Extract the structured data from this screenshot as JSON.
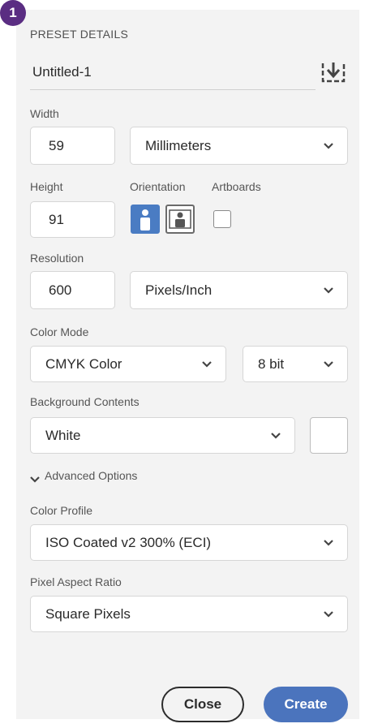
{
  "step_badge": "1",
  "preset": {
    "section_label": "PRESET DETAILS",
    "document_name": "Untitled-1",
    "save_preset_icon": "save-preset-icon"
  },
  "width": {
    "label": "Width",
    "value": "59",
    "unit": "Millimeters"
  },
  "height": {
    "label": "Height",
    "value": "91"
  },
  "orientation": {
    "label": "Orientation",
    "selected": "portrait",
    "options": [
      "portrait",
      "landscape"
    ]
  },
  "artboards": {
    "label": "Artboards",
    "checked": false
  },
  "resolution": {
    "label": "Resolution",
    "value": "600",
    "unit": "Pixels/Inch"
  },
  "color_mode": {
    "label": "Color Mode",
    "mode": "CMYK Color",
    "depth": "8 bit"
  },
  "background": {
    "label": "Background Contents",
    "value": "White",
    "swatch_color": "#ffffff"
  },
  "advanced": {
    "label": "Advanced Options",
    "expanded": true
  },
  "color_profile": {
    "label": "Color Profile",
    "value": "ISO Coated v2 300% (ECI)"
  },
  "pixel_aspect": {
    "label": "Pixel Aspect Ratio",
    "value": "Square Pixels"
  },
  "buttons": {
    "close": "Close",
    "create": "Create"
  },
  "colors": {
    "accent": "#4b74bd",
    "badge": "#5a2d82",
    "panel_bg": "#f3f3f3"
  }
}
